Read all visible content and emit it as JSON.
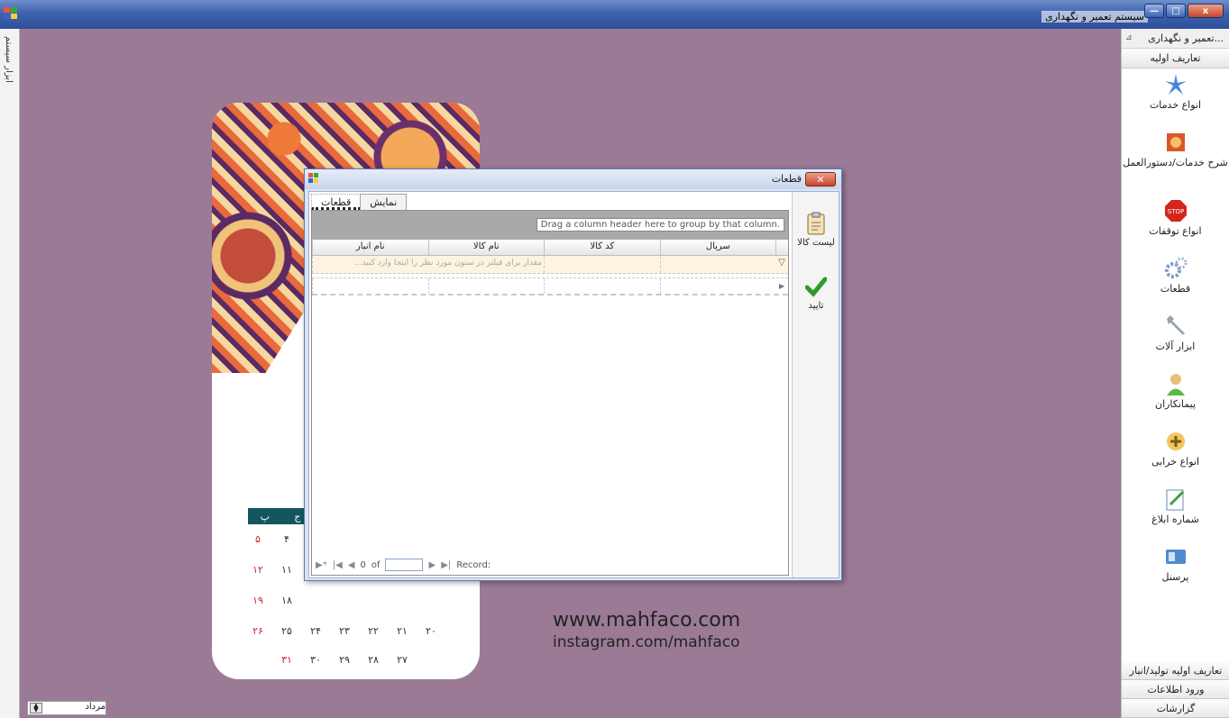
{
  "window": {
    "title": "سیستم تعمیر و نگهداری",
    "controls": {
      "min": "—",
      "max": "□",
      "close": "x"
    }
  },
  "left_strip": {
    "label": "ابزار سیستم"
  },
  "status_box": {
    "value": "مرداد"
  },
  "watermark": {
    "line1": "www.mahfaco.com",
    "line2": "instagram.com/mahfaco"
  },
  "calendar": {
    "header": [
      "ج",
      "پ"
    ],
    "rows": [
      [
        "۵",
        "۴"
      ],
      [
        "۱۲",
        "۱۱"
      ],
      [
        "۱۹",
        "۱۸"
      ],
      [
        "۲۶",
        "۲۵",
        "۲۴",
        "۲۳",
        "۲۲",
        "۲۱",
        "۲۰"
      ],
      [
        "۳۱",
        "۳۰",
        "۲۹",
        "۲۸",
        "۲۷"
      ]
    ]
  },
  "right_panel": {
    "header": "...تعمیر و نگهداری",
    "section_top": "تعاریف اولیه",
    "items": [
      {
        "label": "انواع خدمات",
        "icon": "services-icon"
      },
      {
        "label": "شرح خدمات/دستورالعمل",
        "icon": "instructions-icon"
      },
      {
        "label": "انواع توقفات",
        "icon": "stop-icon"
      },
      {
        "label": "قطعات",
        "icon": "gears-icon"
      },
      {
        "label": "ابزار آلات",
        "icon": "wrench-icon"
      },
      {
        "label": "پیمانکاران",
        "icon": "contractor-icon"
      },
      {
        "label": "انواع خرابی",
        "icon": "breakdown-icon"
      },
      {
        "label": "شماره ابلاغ",
        "icon": "edit-note-icon"
      },
      {
        "label": "پرسنل",
        "icon": "personnel-icon"
      }
    ],
    "sections_bottom": [
      "تعاریف اولیه تولید/انبار",
      "ورود اطلاعات",
      "گزارشات"
    ]
  },
  "dialog": {
    "title": "قطعات",
    "tabs": [
      "قطعات",
      "نمایش"
    ],
    "group_hint": "Drag a column header here to group by that column.",
    "columns": [
      "سریال",
      "کد کالا",
      "نام کالا",
      "نام انبار"
    ],
    "filter_placeholder": "مقدار برای فیلتر در ستون مورد نظر را اینجا وارد کنید...",
    "navigator": {
      "record_label": "Record:",
      "of_label": "of",
      "current": "0"
    },
    "actions": [
      {
        "label": "لیست کالا",
        "icon": "clipboard-icon"
      },
      {
        "label": "تایید",
        "icon": "checkmark-icon"
      }
    ]
  },
  "colors": {
    "desktop": "#9b7a96",
    "titlebar": "#3d63b0",
    "close": "#c8452a",
    "confirm": "#2e9a2a"
  }
}
